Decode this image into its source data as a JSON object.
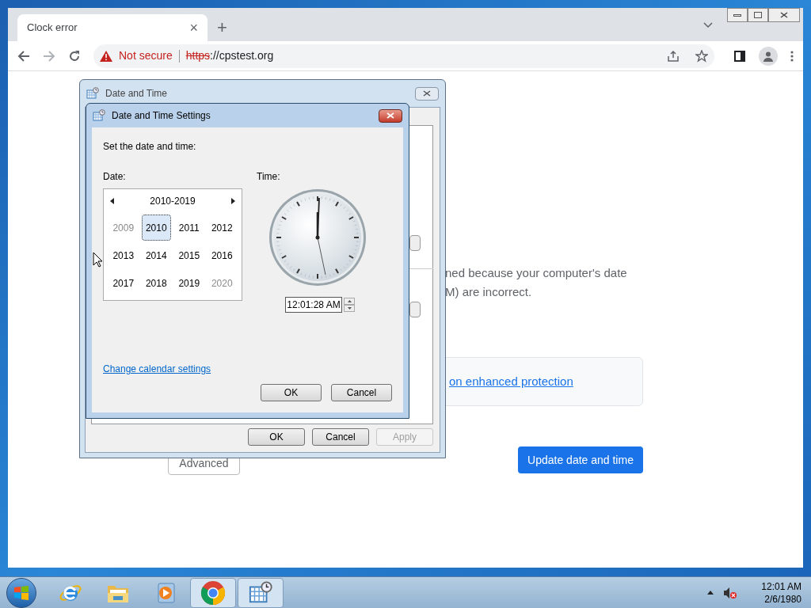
{
  "browser": {
    "tab": {
      "title": "Clock error",
      "close": "×"
    },
    "new_tab": "+",
    "security": "Not secure",
    "url_scheme": "https",
    "url_rest": "://cpstest.org"
  },
  "page": {
    "message_lines": [
      "ned because your computer's date",
      "M) are incorrect."
    ],
    "protection_link": "on enhanced protection",
    "advanced_button": "Advanced",
    "primary_button": "Update date and time"
  },
  "outer_dialog": {
    "title": "Date and Time",
    "buttons": [
      {
        "label": "OK",
        "disabled": false
      },
      {
        "label": "Cancel",
        "disabled": false
      },
      {
        "label": "Apply",
        "disabled": true
      }
    ]
  },
  "settings_dialog": {
    "title": "Date and Time Settings",
    "prompt": "Set the date and time:",
    "date_label": "Date:",
    "time_label": "Time:",
    "calendar": {
      "header": "2010-2019",
      "years": [
        {
          "label": "2009",
          "selected": false,
          "dimmed": true
        },
        {
          "label": "2010",
          "selected": true,
          "dimmed": false
        },
        {
          "label": "2011",
          "selected": false,
          "dimmed": false
        },
        {
          "label": "2012",
          "selected": false,
          "dimmed": false
        },
        {
          "label": "2013",
          "selected": false,
          "dimmed": false
        },
        {
          "label": "2014",
          "selected": false,
          "dimmed": false
        },
        {
          "label": "2015",
          "selected": false,
          "dimmed": false
        },
        {
          "label": "2016",
          "selected": false,
          "dimmed": false
        },
        {
          "label": "2017",
          "selected": false,
          "dimmed": false
        },
        {
          "label": "2018",
          "selected": false,
          "dimmed": false
        },
        {
          "label": "2019",
          "selected": false,
          "dimmed": false
        },
        {
          "label": "2020",
          "selected": false,
          "dimmed": true
        }
      ]
    },
    "time_value": "12:01:28 AM",
    "calendar_link": "Change calendar settings",
    "buttons": [
      "OK",
      "Cancel"
    ]
  },
  "taskbar": {
    "apps": [
      {
        "kind": "ie",
        "active": false
      },
      {
        "kind": "folder",
        "active": false
      },
      {
        "kind": "media",
        "active": false
      },
      {
        "kind": "chrome",
        "active": true
      },
      {
        "kind": "datetime",
        "active": true
      }
    ],
    "clock": {
      "time": "12:01 AM",
      "date": "2/6/1980"
    }
  }
}
